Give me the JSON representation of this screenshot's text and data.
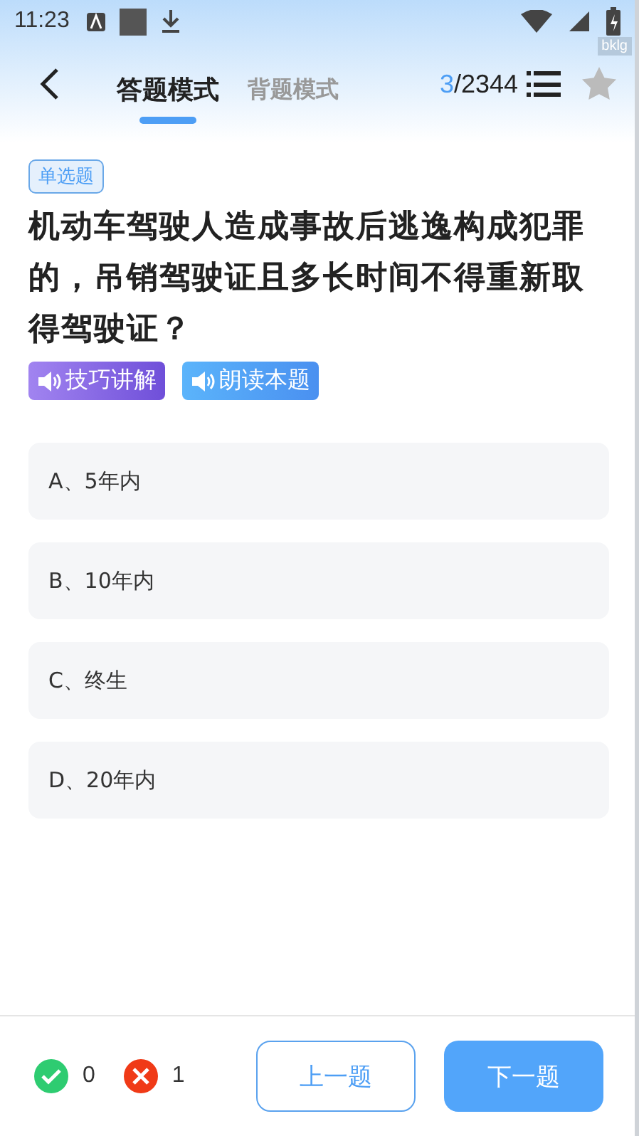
{
  "status_bar": {
    "time": "11:23"
  },
  "debug_badge": "bklg",
  "header": {
    "tabs": [
      {
        "label": "答题模式",
        "selected": true
      },
      {
        "label": "背题模式",
        "selected": false
      }
    ],
    "counter": {
      "current": "3",
      "total": "/2344"
    },
    "favorited": false
  },
  "question": {
    "type_tag": "单选题",
    "text": "机动车驾驶人造成事故后逃逸构成犯罪的，吊销驾驶证且多长时间不得重新取得驾驶证？",
    "audio_buttons": [
      {
        "label": "技巧讲解",
        "kind": "explain"
      },
      {
        "label": "朗读本题",
        "kind": "read"
      }
    ],
    "options": [
      {
        "label": "A、5年内",
        "selected": false
      },
      {
        "label": "B、10年内",
        "selected": false
      },
      {
        "label": "C、终生",
        "selected": false
      },
      {
        "label": "D、20年内",
        "selected": false
      }
    ]
  },
  "footer": {
    "correct_count": "0",
    "wrong_count": "1",
    "prev_button": "上一题",
    "next_button": "下一题"
  }
}
